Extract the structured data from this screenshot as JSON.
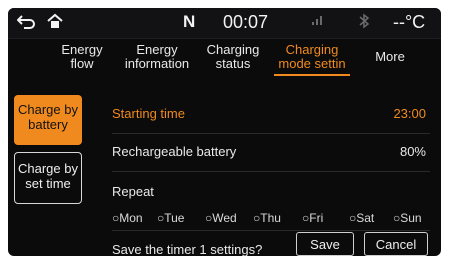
{
  "status": {
    "back_icon": "back-arrow-icon",
    "home_icon": "home-icon",
    "gear": "N",
    "time": "00:07",
    "signal_icon": "signal-icon",
    "bluetooth_icon": "bluetooth-icon",
    "temperature": "--°C"
  },
  "tabs": [
    {
      "label1": "Energy",
      "label2": "flow"
    },
    {
      "label1": "Energy",
      "label2": "information"
    },
    {
      "label1": "Charging",
      "label2": "status"
    },
    {
      "label1": "Charging",
      "label2": "mode settin"
    },
    {
      "label1": "More",
      "label2": ""
    }
  ],
  "active_tab": 3,
  "side": {
    "battery": {
      "line1": "Charge by",
      "line2": "battery"
    },
    "time": {
      "line1": "Charge by",
      "line2": "set time"
    }
  },
  "settings": {
    "starting_time": {
      "label": "Starting time",
      "value": "23:00"
    },
    "rechargeable": {
      "label": "Rechargeable battery",
      "value": "80%"
    },
    "repeat": {
      "label": "Repeat"
    },
    "days": [
      "○Mon",
      "○Tue",
      "○Wed",
      "○Thu",
      "○Fri",
      "○Sat",
      "○Sun"
    ]
  },
  "save": {
    "question": "Save the timer 1 settings?",
    "save_label": "Save",
    "cancel_label": "Cancel"
  },
  "colors": {
    "accent": "#f08a1e",
    "background": "#0b0b0c"
  }
}
